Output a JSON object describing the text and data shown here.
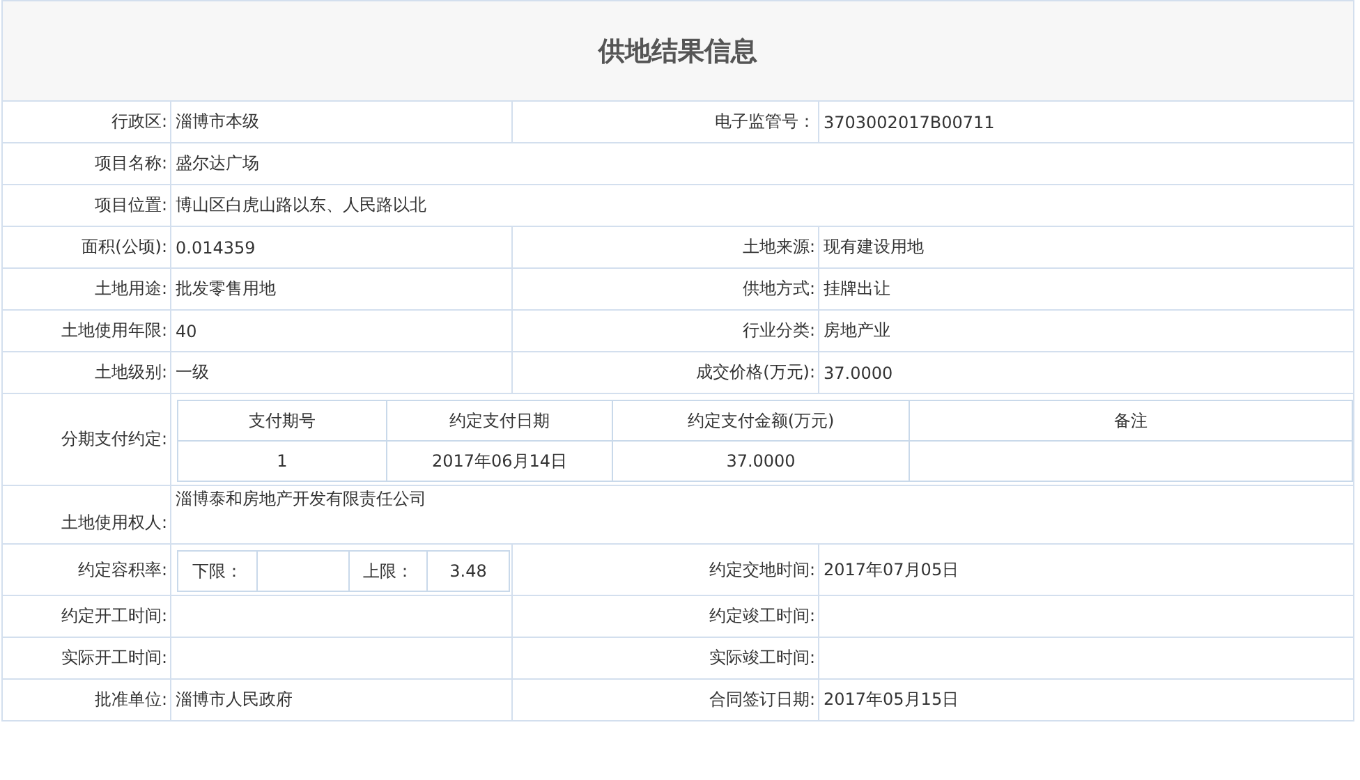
{
  "title": "供地结果信息",
  "rows": [
    {
      "kind": "pair",
      "cells": [
        {
          "label": "行政区:",
          "value": "淄博市本级"
        },
        {
          "label": "电子监管号：",
          "value": "3703002017B00711"
        }
      ]
    },
    {
      "kind": "single",
      "label": "项目名称:",
      "value": "盛尔达广场"
    },
    {
      "kind": "single",
      "label": "项目位置:",
      "value": "博山区白虎山路以东、人民路以北"
    },
    {
      "kind": "pair",
      "cells": [
        {
          "label": "面积(公顷):",
          "value": "0.014359"
        },
        {
          "label": "土地来源:",
          "value": "现有建设用地"
        }
      ]
    },
    {
      "kind": "pair",
      "cells": [
        {
          "label": "土地用途:",
          "value": "批发零售用地"
        },
        {
          "label": "供地方式:",
          "value": "挂牌出让"
        }
      ]
    },
    {
      "kind": "pair",
      "cells": [
        {
          "label": "土地使用年限:",
          "value": "40"
        },
        {
          "label": "行业分类:",
          "value": "房地产业"
        }
      ]
    },
    {
      "kind": "pair",
      "cells": [
        {
          "label": "土地级别:",
          "value": "一级"
        },
        {
          "label": "成交价格(万元):",
          "value": "37.0000"
        }
      ]
    },
    {
      "kind": "payments",
      "label": "分期支付约定:",
      "columns": [
        "支付期号",
        "约定支付日期",
        "约定支付金额(万元)",
        "备注"
      ],
      "rows": [
        {
          "period": "1",
          "date": "2017年06月14日",
          "amount": "37.0000"
        }
      ]
    },
    {
      "kind": "owner",
      "label": "土地使用权人:",
      "value": "淄博泰和房地产开发有限责任公司"
    },
    {
      "kind": "ratio",
      "label": "约定容积率:",
      "lower_label": "下限：",
      "upper_label": "上限：",
      "upper_value": "3.48",
      "right": {
        "label": "约定交地时间:",
        "value": "2017年07月05日"
      }
    },
    {
      "kind": "pair",
      "cells": [
        {
          "label": "约定开工时间:"
        },
        {
          "label": "约定竣工时间:"
        }
      ]
    },
    {
      "kind": "pair",
      "cells": [
        {
          "label": "实际开工时间:"
        },
        {
          "label": "实际竣工时间:"
        }
      ]
    },
    {
      "kind": "pair",
      "cells": [
        {
          "label": "批准单位:",
          "value": "淄博市人民政府"
        },
        {
          "label": "合同签订日期:",
          "value": "2017年05月15日"
        }
      ]
    }
  ]
}
